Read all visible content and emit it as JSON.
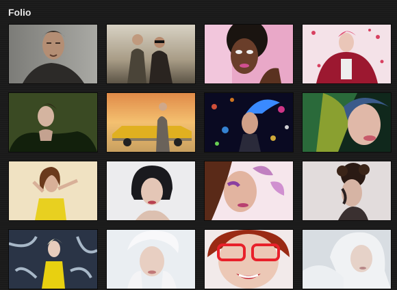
{
  "header": {
    "title": "Folio"
  },
  "gallery": {
    "items": [
      {
        "subject": "man-portrait"
      },
      {
        "subject": "couple-desert"
      },
      {
        "subject": "woman-pink-makeup"
      },
      {
        "subject": "woman-petals"
      },
      {
        "subject": "woman-green-feathers"
      },
      {
        "subject": "woman-yellow-car"
      },
      {
        "subject": "woman-blue-hair-lights"
      },
      {
        "subject": "woman-colorful-hair"
      },
      {
        "subject": "woman-yellow-dress"
      },
      {
        "subject": "woman-bob-hair"
      },
      {
        "subject": "woman-butterfly-makeup"
      },
      {
        "subject": "woman-lace-updo"
      },
      {
        "subject": "woman-yellow-feathers"
      },
      {
        "subject": "woman-white-fur"
      },
      {
        "subject": "woman-red-glasses"
      },
      {
        "subject": "woman-white-hair"
      }
    ]
  }
}
